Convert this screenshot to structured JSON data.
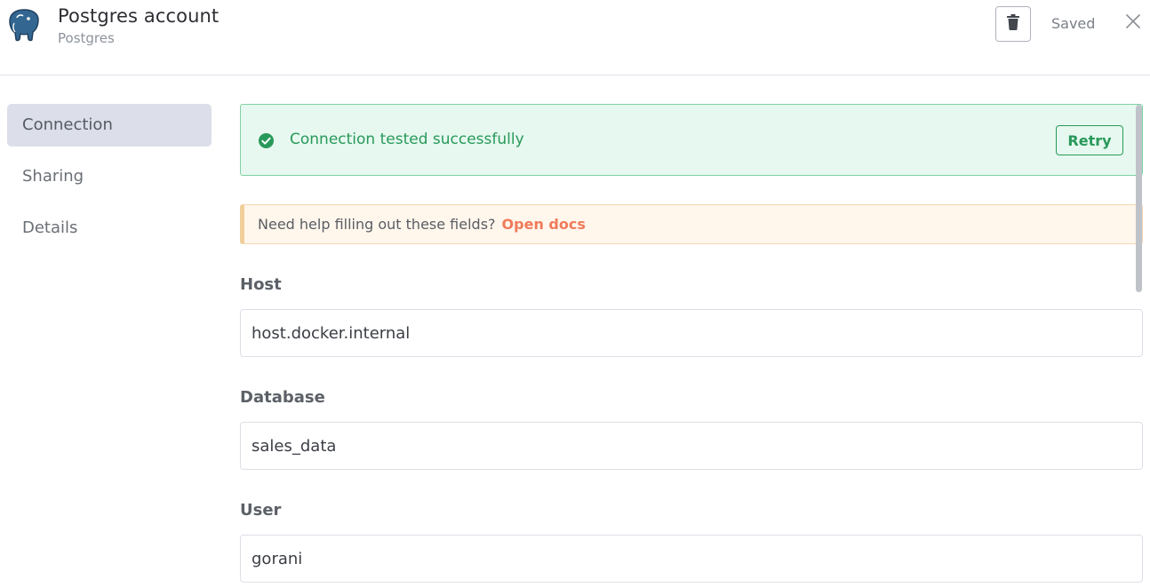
{
  "header": {
    "title": "Postgres account",
    "subtitle": "Postgres",
    "logo_icon": "postgres-elephant-icon",
    "delete_icon": "trash-icon",
    "status": "Saved",
    "close_icon": "close-icon"
  },
  "sidebar": {
    "items": [
      {
        "label": "Connection",
        "active": true
      },
      {
        "label": "Sharing",
        "active": false
      },
      {
        "label": "Details",
        "active": false
      }
    ]
  },
  "banner": {
    "icon": "check-circle-icon",
    "message": "Connection tested successfully",
    "retry_label": "Retry",
    "color": "#28995a"
  },
  "help": {
    "text": "Need help filling out these fields?",
    "link": "Open docs",
    "link_color": "#ef7a5a"
  },
  "fields": [
    {
      "label": "Host",
      "value": "host.docker.internal"
    },
    {
      "label": "Database",
      "value": "sales_data"
    },
    {
      "label": "User",
      "value": "gorani"
    }
  ]
}
